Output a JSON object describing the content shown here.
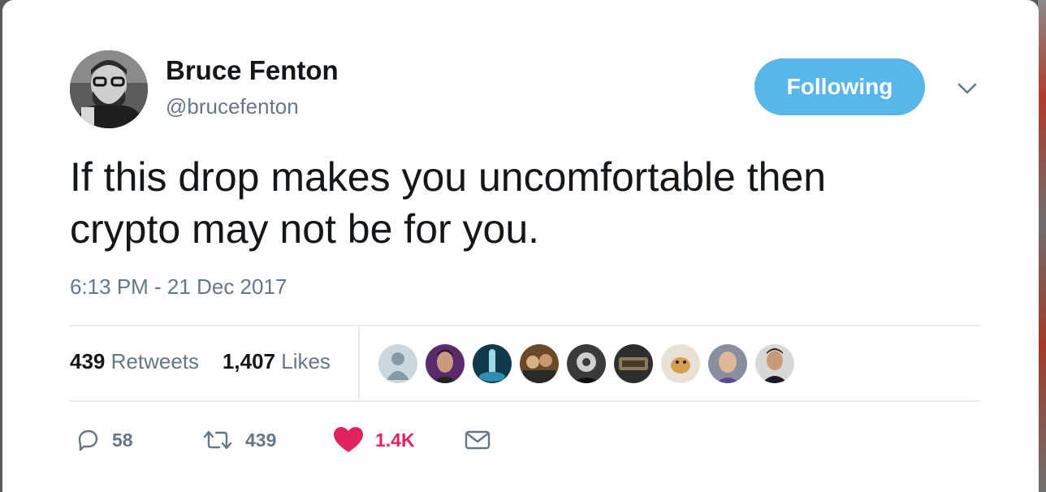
{
  "author": {
    "name": "Bruce Fenton",
    "handle": "@brucefenton"
  },
  "follow_button": {
    "label": "Following"
  },
  "tweet": {
    "line1": "If this drop makes you uncomfortable then",
    "line2": "crypto may not be for you.",
    "timestamp": "6:13 PM - 21 Dec 2017"
  },
  "stats": {
    "retweets_count": "439",
    "retweets_label": "Retweets",
    "likes_count": "1,407",
    "likes_label": "Likes"
  },
  "actions": {
    "reply_count": "58",
    "retweet_count": "439",
    "like_count": "1.4K"
  },
  "icons": {
    "reply": "reply-icon",
    "retweet": "retweet-icon",
    "like": "heart-icon",
    "dm": "envelope-icon",
    "more": "chevron-down-icon"
  },
  "colors": {
    "follow_bg": "#58b6e9",
    "text_primary": "#14171a",
    "text_secondary": "#657786",
    "like_red": "#e0245e",
    "divider": "#e6ecf0"
  }
}
